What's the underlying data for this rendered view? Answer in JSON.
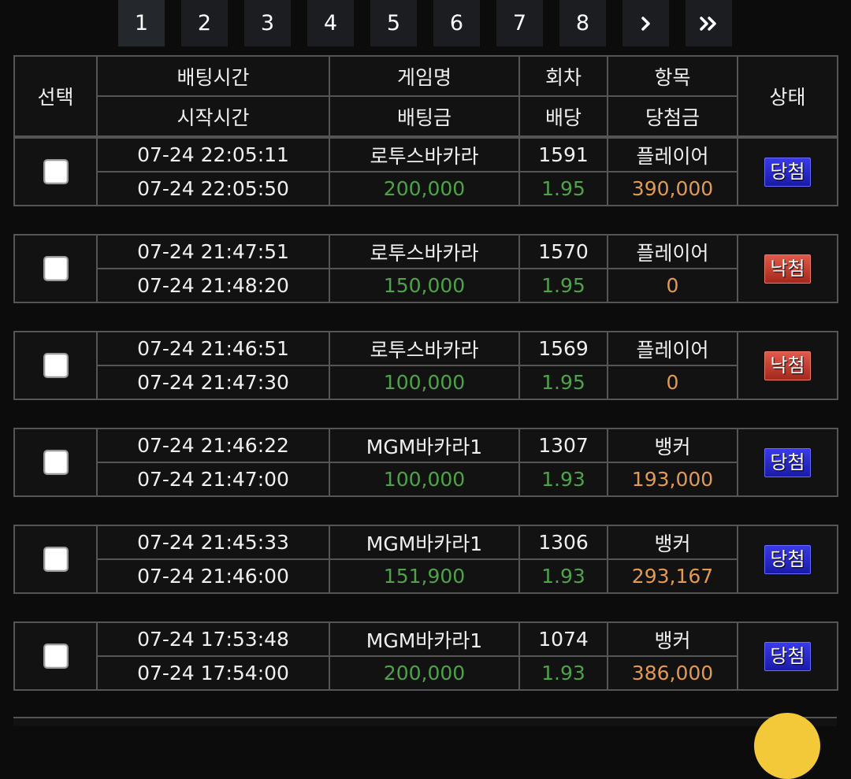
{
  "pagination": {
    "pages": [
      "1",
      "2",
      "3",
      "4",
      "5",
      "6",
      "7",
      "8"
    ],
    "next_icon": "chevron-right-icon",
    "last_icon": "double-chevron-right-icon"
  },
  "header": {
    "select": "선택",
    "bet_time": "배팅시간",
    "start_time": "시작시간",
    "game_name": "게임명",
    "bet_amount": "배팅금",
    "round": "회차",
    "odds": "배당",
    "item": "항목",
    "win_amount": "당첨금",
    "status": "상태"
  },
  "colors": {
    "background": "#0c0c0c",
    "amount_green": "#4fa24a",
    "win_amount_orange": "#e49a4e",
    "badge_win": "#2a2ad0",
    "badge_lose": "#c0392b"
  },
  "bets": [
    {
      "bet_time": "07-24 22:05:11",
      "start_time": "07-24 22:05:50",
      "game": "로투스바카라",
      "bet_amount": "200,000",
      "round": "1591",
      "odds": "1.95",
      "item": "플레이어",
      "win_amount": "390,000",
      "status": "당첨",
      "status_type": "win"
    },
    {
      "bet_time": "07-24 21:47:51",
      "start_time": "07-24 21:48:20",
      "game": "로투스바카라",
      "bet_amount": "150,000",
      "round": "1570",
      "odds": "1.95",
      "item": "플레이어",
      "win_amount": "0",
      "status": "낙첨",
      "status_type": "lose"
    },
    {
      "bet_time": "07-24 21:46:51",
      "start_time": "07-24 21:47:30",
      "game": "로투스바카라",
      "bet_amount": "100,000",
      "round": "1569",
      "odds": "1.95",
      "item": "플레이어",
      "win_amount": "0",
      "status": "낙첨",
      "status_type": "lose"
    },
    {
      "bet_time": "07-24 21:46:22",
      "start_time": "07-24 21:47:00",
      "game": "MGM바카라1",
      "bet_amount": "100,000",
      "round": "1307",
      "odds": "1.93",
      "item": "뱅커",
      "win_amount": "193,000",
      "status": "당첨",
      "status_type": "win"
    },
    {
      "bet_time": "07-24 21:45:33",
      "start_time": "07-24 21:46:00",
      "game": "MGM바카라1",
      "bet_amount": "151,900",
      "round": "1306",
      "odds": "1.93",
      "item": "뱅커",
      "win_amount": "293,167",
      "status": "당첨",
      "status_type": "win"
    },
    {
      "bet_time": "07-24 17:53:48",
      "start_time": "07-24 17:54:00",
      "game": "MGM바카라1",
      "bet_amount": "200,000",
      "round": "1074",
      "odds": "1.93",
      "item": "뱅커",
      "win_amount": "386,000",
      "status": "당첨",
      "status_type": "win"
    }
  ]
}
